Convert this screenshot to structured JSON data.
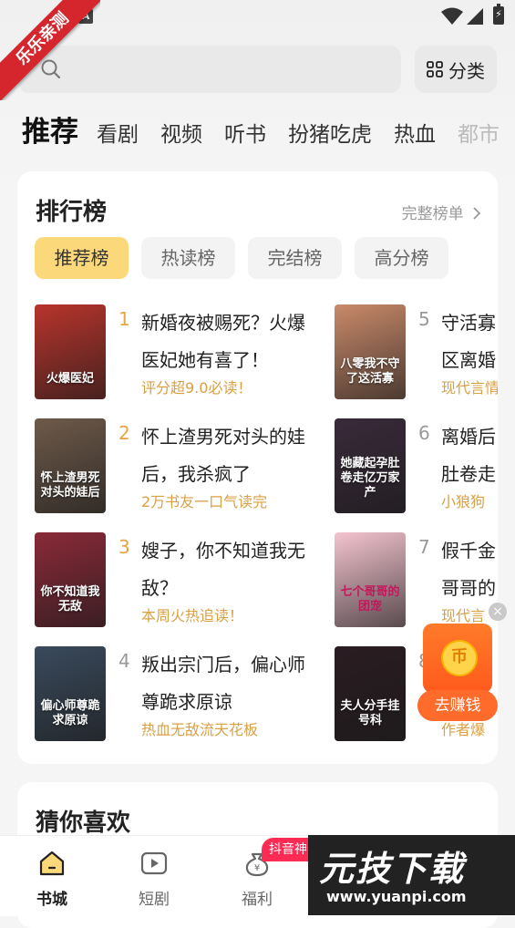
{
  "watermark_ribbon": "乐乐亲测",
  "status_bar": {
    "badge": "A",
    "battery": "⚡"
  },
  "search": {
    "placeholder": ""
  },
  "category_button": {
    "label": "分类"
  },
  "tabs": [
    {
      "label": "推荐",
      "active": true
    },
    {
      "label": "看剧"
    },
    {
      "label": "视频"
    },
    {
      "label": "听书"
    },
    {
      "label": "扮猪吃虎"
    },
    {
      "label": "热血"
    },
    {
      "label": "都市"
    }
  ],
  "ranking": {
    "title": "排行榜",
    "more": "完整榜单",
    "subtabs": [
      "推荐榜",
      "热读榜",
      "完结榜",
      "高分榜"
    ],
    "books": [
      {
        "rank": "1",
        "title": "新婚夜被赐死？火爆医妃她有喜了！",
        "desc": "评分超9.0必读！",
        "cover_text": "火爆医妃",
        "cover_color": "#b8342c"
      },
      {
        "rank": "2",
        "title": "怀上渣男死对头的娃后，我杀疯了",
        "desc": "2万书友一口气读完",
        "cover_text": "怀上渣男死对头的娃后",
        "cover_color": "#6e5a4a"
      },
      {
        "rank": "3",
        "title": "嫂子，你不知道我无敌？",
        "desc": "本周火热追读！",
        "cover_text": "你不知道我无敌",
        "cover_color": "#8a2a38"
      },
      {
        "rank": "4",
        "title": "叛出宗门后，偏心师尊跪求原谅",
        "desc": "热血无敌流天花板",
        "cover_text": "偏心师尊跪求原谅",
        "cover_color": "#3a4a5c"
      },
      {
        "rank": "5",
        "title": "守活寡区离婚",
        "desc": "现代言情",
        "cover_text": "八零我不守了这活寡",
        "cover_color": "#c98a6a"
      },
      {
        "rank": "6",
        "title": "离婚后肚卷走",
        "desc": "小狼狗",
        "cover_text": "她藏起孕肚卷走亿万家产",
        "cover_color": "#3a2a3a"
      },
      {
        "rank": "7",
        "title": "假千金哥哥的",
        "desc": "现代言",
        "cover_text": "七个哥哥的团宠",
        "cover_color": "#f4c4d0"
      },
      {
        "rank": "8",
        "title": "",
        "desc": "作者爆",
        "cover_text": "夫人分手挂号科",
        "cover_color": "#2a1c22"
      }
    ]
  },
  "float_ad": {
    "close": "×",
    "coin": "币",
    "button": "去赚钱"
  },
  "guess_like": {
    "title": "猜你喜欢"
  },
  "bottom_nav": [
    {
      "label": "书城",
      "icon": "home-icon",
      "active": true
    },
    {
      "label": "短剧",
      "icon": "play-icon"
    },
    {
      "label": "福利",
      "icon": "money-bag-icon"
    }
  ],
  "promo_badge": "抖音神券",
  "site_watermark": {
    "title": "元技下载",
    "url": "www.yuanpi.com"
  }
}
